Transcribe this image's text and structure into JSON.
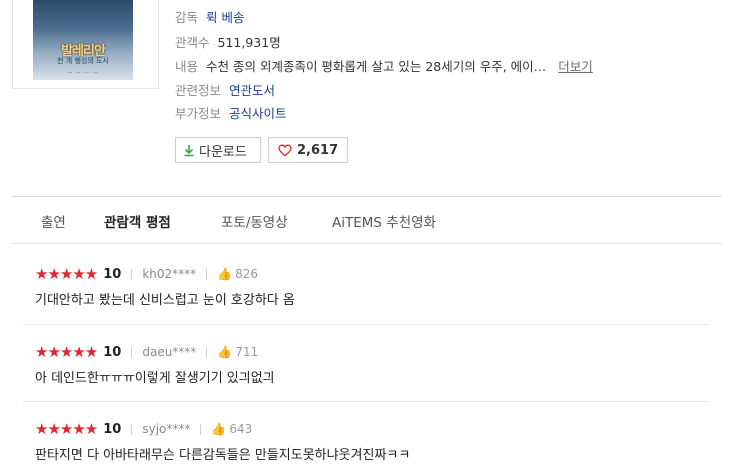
{
  "movie": {
    "poster_title": "발레리안",
    "poster_subtitle": "천 개 행성의 도시",
    "director_label": "감독",
    "director": "뤽 베송",
    "audience_label": "관객수",
    "audience": "511,931명",
    "content_label": "내용",
    "content": "수천 종의 외계종족이 평화롭게 살고 있는 28세기의 우주, 에이…",
    "more_label": "더보기",
    "related_label": "관련정보",
    "related_link": "연관도서",
    "extra_label": "부가정보",
    "extra_link": "공식사이트"
  },
  "actions": {
    "download_label": "다운로드",
    "like_count": "2,617"
  },
  "tabs": [
    "출연",
    "관람객 평점",
    "포토/동영상",
    "AiTEMS 추천영화"
  ],
  "active_tab": "관람객 평점",
  "reviews": [
    {
      "stars": "★★★★★",
      "score": "10",
      "user": "kh02****",
      "likes": "826",
      "text": "기대안하고 봤는데 신비스럽고 눈이 호강하다 옴"
    },
    {
      "stars": "★★★★★",
      "score": "10",
      "user": "daeu****",
      "likes": "711",
      "text": "아 데인드한ㅠㅠㅠ이렇게 잘생기기 있긔없긔"
    },
    {
      "stars": "★★★★★",
      "score": "10",
      "user": "syjo****",
      "likes": "643",
      "text": "판타지면 다 아바타래무슨 다른감독들은 만들지도못하냐웃겨진짜ㅋㅋ"
    }
  ],
  "colors": {
    "star": "#e1262d",
    "link": "#1a3f8f",
    "download_icon": "#3aa43a",
    "heart": "#e1262d"
  }
}
